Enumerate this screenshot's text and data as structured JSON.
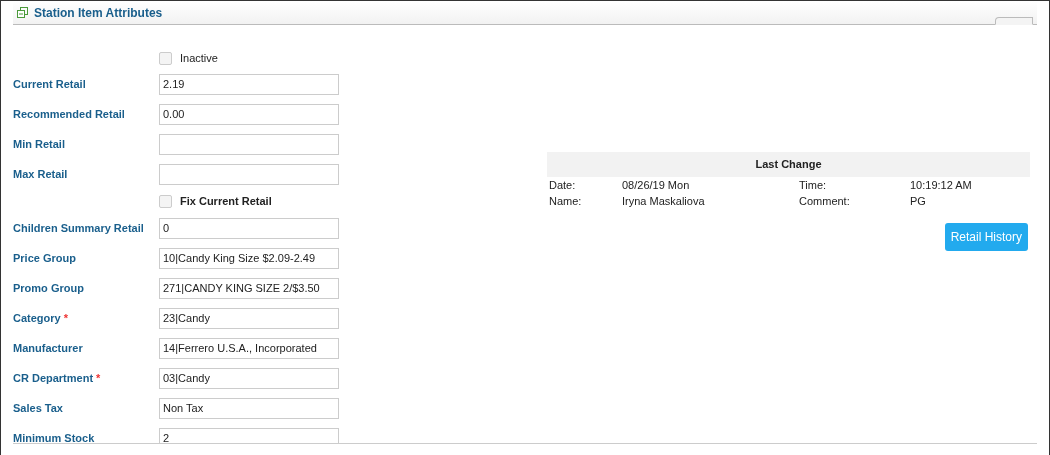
{
  "panel": {
    "title": "Station Item Attributes"
  },
  "fields": [
    {
      "kind": "checkbox",
      "label": "Inactive",
      "checked": false
    },
    {
      "kind": "input",
      "label": "Current Retail",
      "value": "2.19"
    },
    {
      "kind": "input",
      "label": "Recommended Retail",
      "value": "0.00"
    },
    {
      "kind": "input",
      "label": "Min Retail"
    },
    {
      "kind": "input",
      "label": "Max Retail"
    },
    {
      "kind": "checkbox",
      "label": "Fix Current Retail",
      "checked": false
    },
    {
      "kind": "input",
      "label": "Children Summary Retail",
      "value": "0"
    },
    {
      "kind": "input",
      "label": "Price Group",
      "value": "10|Candy King Size $2.09-2.49"
    },
    {
      "kind": "input",
      "label": "Promo Group",
      "value": "271|CANDY KING SIZE 2/$3.50"
    },
    {
      "kind": "input",
      "label": "Category",
      "required_mark": "*",
      "value": "23|Candy"
    },
    {
      "kind": "input",
      "label": "Manufacturer",
      "value": "14|Ferrero U.S.A., Incorporated"
    },
    {
      "kind": "input",
      "label": "CR Department",
      "required_mark": "*",
      "value": "03|Candy"
    },
    {
      "kind": "input",
      "label": "Sales Tax",
      "value": "Non Tax"
    },
    {
      "kind": "input",
      "label": "Minimum Stock",
      "value": "2"
    }
  ],
  "last_change": {
    "title": "Last Change",
    "rows": [
      {
        "label_1": "Date:",
        "value_1": "08/26/19 Mon",
        "label_2": "Time:",
        "value_2": "10:19:12 AM"
      },
      {
        "label_1": "Name:",
        "value_1": "Iryna Maskaliova",
        "label_2": "Comment:",
        "value_2": "PG"
      }
    ]
  },
  "buttons": [
    "Retail History"
  ]
}
